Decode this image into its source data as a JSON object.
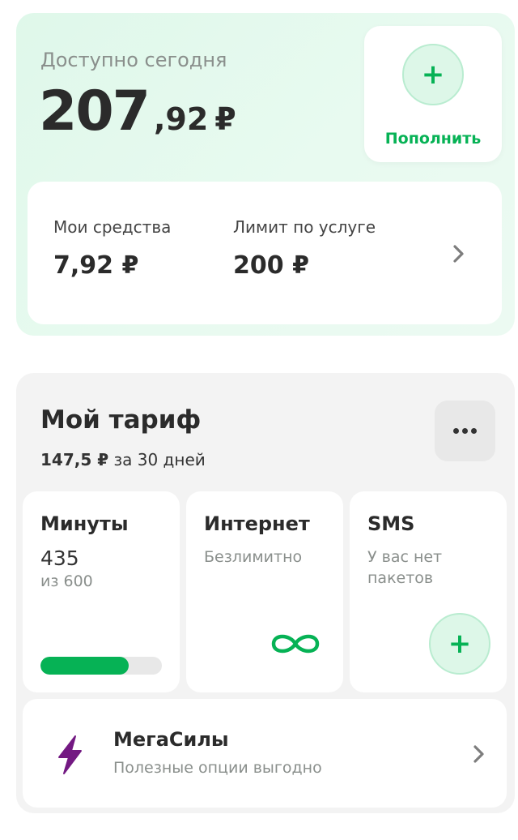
{
  "balance": {
    "available_label": "Доступно сегодня",
    "amount_integer": "207",
    "amount_fraction": ",92",
    "currency": "₽",
    "topup_icon": "plus-icon",
    "topup_label": "Пополнить",
    "own_funds_label": "Мои средства",
    "own_funds_value": "7,92 ₽",
    "limit_label": "Лимит по услуге",
    "limit_value": "200 ₽"
  },
  "tariff": {
    "title": "Мой тариф",
    "price_amount": "147,5 ₽",
    "price_period": "за 30 дней",
    "more_icon": "more-dots-icon",
    "packages": {
      "minutes": {
        "title": "Минуты",
        "remaining": "435",
        "total": "из 600",
        "progress_fraction": 0.725
      },
      "internet": {
        "title": "Интернет",
        "status": "Безлимитно",
        "icon": "infinity-icon"
      },
      "sms": {
        "title": "SMS",
        "status": "У вас нет пакетов",
        "icon": "plus-icon"
      }
    },
    "megasily": {
      "icon": "lightning-icon",
      "title": "МегаСилы",
      "subtitle": "Полезные опции выгодно"
    }
  },
  "colors": {
    "accent_green": "#06b255",
    "balance_bg": "#e3f8ec",
    "lightning_purple": "#731982",
    "muted_text": "#8a8f8c"
  }
}
